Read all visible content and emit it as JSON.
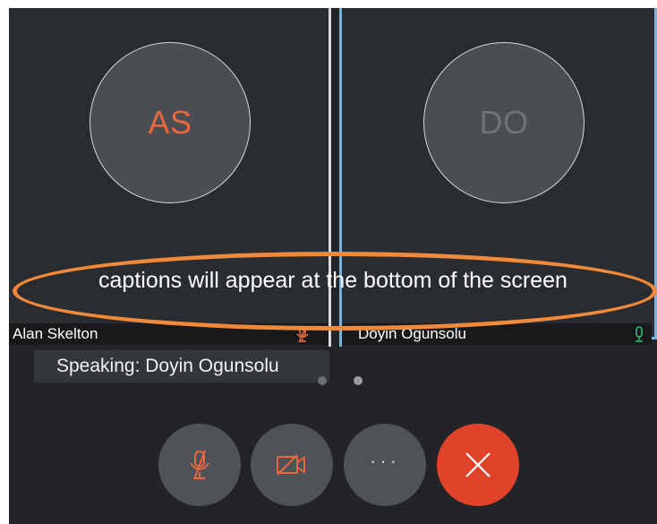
{
  "participants": [
    {
      "initials": "AS",
      "name": "Alan Skelton",
      "mic": "muted",
      "initials_color": "#e8693f"
    },
    {
      "initials": "DO",
      "name": "Doyin Ogunsolu",
      "mic": "active",
      "initials_color": "#6f7276"
    }
  ],
  "caption": {
    "text": "captions will appear at the bottom of the screen"
  },
  "speaking": {
    "text": "Speaking: Doyin Ogunsolu"
  },
  "controls": {
    "mic": {
      "icon": "mic-muted-icon"
    },
    "camera": {
      "icon": "camera-off-icon"
    },
    "more": {
      "label": "···",
      "icon": "more-icon"
    },
    "end": {
      "icon": "close-icon"
    }
  },
  "colors": {
    "accent_orange": "#e8693f",
    "highlight_ring": "#f08a3a",
    "active_speaker_border": "#7ab3d9",
    "end_call": "#e0432a",
    "mic_active": "#2fbf71"
  }
}
